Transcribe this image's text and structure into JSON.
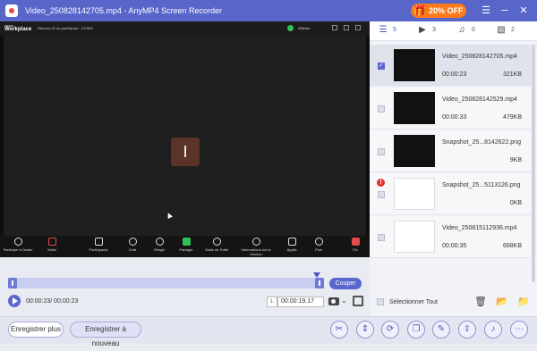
{
  "window": {
    "title": "Video_250828142705.mp4  -  AnyMP4 Screen Recorder",
    "promo": "20% OFF"
  },
  "zoom": {
    "brand": "zoom",
    "brand_sub": "Workplace",
    "meeting_info": "Réunion ID du participant : 147862",
    "view_label": "Afficher",
    "avatar_letter": "I",
    "toolbar": [
      {
        "label": "Participer à l'audio"
      },
      {
        "label": "Vidéo"
      },
      {
        "label": "Participants"
      },
      {
        "label": "Chat"
      },
      {
        "label": "Réagir"
      },
      {
        "label": "Partager"
      },
      {
        "label": "Outils de l'hôte"
      },
      {
        "label": "Informations sur la réunion"
      },
      {
        "label": "Applis"
      },
      {
        "label": "Plus"
      },
      {
        "label": "Fin"
      }
    ]
  },
  "player": {
    "cut_label": "Couper",
    "time": "00:00:23/ 00:00:23",
    "speed": "1.",
    "timecode": "00:00:19.17"
  },
  "bottom": {
    "save_more": "Enregistrer plus",
    "save_new": "Enregistrer à nouveau"
  },
  "tabs": [
    {
      "icon": "list-icon",
      "count": "5"
    },
    {
      "icon": "video-icon",
      "count": "3"
    },
    {
      "icon": "audio-icon",
      "count": "0"
    },
    {
      "icon": "image-icon",
      "count": "2"
    }
  ],
  "files": [
    {
      "name": "Video_250828142705.mp4",
      "duration": "00:00:23",
      "size": "321KB"
    },
    {
      "name": "Video_250828142529.mp4",
      "duration": "00:00:33",
      "size": "479KB"
    },
    {
      "name": "Snapshot_25...8142622.png",
      "duration": "",
      "size": "9KB"
    },
    {
      "name": "Snapshot_25...5113126.png",
      "duration": "",
      "size": "0KB"
    },
    {
      "name": "Video_250815112936.mp4",
      "duration": "00:00:35",
      "size": "688KB"
    }
  ],
  "select_all": "Sélectionner Tout"
}
